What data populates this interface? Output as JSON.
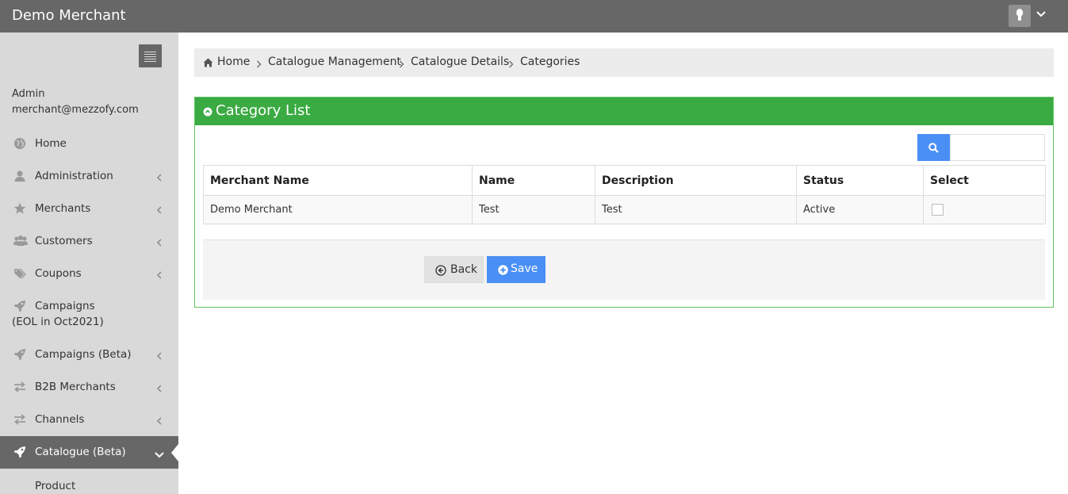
{
  "app": {
    "title": "Demo Merchant"
  },
  "user": {
    "role": "Admin",
    "email": "merchant@mezzofy.com",
    "avatar_icon": "user-avatar-icon",
    "menu_icon": "chevron-down-icon"
  },
  "sidebar": {
    "toggle_icon": "hamburger-icon",
    "items": [
      {
        "label": "Home",
        "icon": "globe-icon",
        "has_submenu": false
      },
      {
        "label": "Administration",
        "icon": "user-icon",
        "has_submenu": true
      },
      {
        "label": "Merchants",
        "icon": "star-icon",
        "has_submenu": true
      },
      {
        "label": "Customers",
        "icon": "users-icon",
        "has_submenu": true
      },
      {
        "label": "Coupons",
        "icon": "tags-icon",
        "has_submenu": true
      },
      {
        "label": "Campaigns",
        "label2": "(EOL in Oct2021)",
        "icon": "rocket-icon",
        "has_submenu": false
      },
      {
        "label": "Campaigns (Beta)",
        "icon": "rocket-icon",
        "has_submenu": true
      },
      {
        "label": "B2B Merchants",
        "icon": "exchange-icon",
        "has_submenu": true
      },
      {
        "label": "Channels",
        "icon": "exchange-icon",
        "has_submenu": true
      },
      {
        "label": "Catalogue (Beta)",
        "icon": "rocket-icon",
        "has_submenu": true,
        "active": true
      }
    ],
    "sub_items": [
      {
        "label": "Product"
      }
    ]
  },
  "breadcrumb": {
    "items": [
      "Home",
      "Catalogue Management",
      "Catalogue Details",
      "Categories"
    ]
  },
  "panel": {
    "title": "Category List",
    "search": {
      "placeholder": "",
      "value": ""
    }
  },
  "table": {
    "columns": [
      "Merchant Name",
      "Name",
      "Description",
      "Status",
      "Select"
    ],
    "rows": [
      {
        "merchant_name": "Demo Merchant",
        "name": "Test",
        "description": "Test",
        "status": "Active",
        "selected": false
      }
    ]
  },
  "actions": {
    "back_label": "Back",
    "save_label": "Save"
  },
  "colors": {
    "topbar": "#676767",
    "sidebar": "#d9d9d9",
    "panel_header": "#3aaa42",
    "primary_button": "#4a8ff5"
  }
}
